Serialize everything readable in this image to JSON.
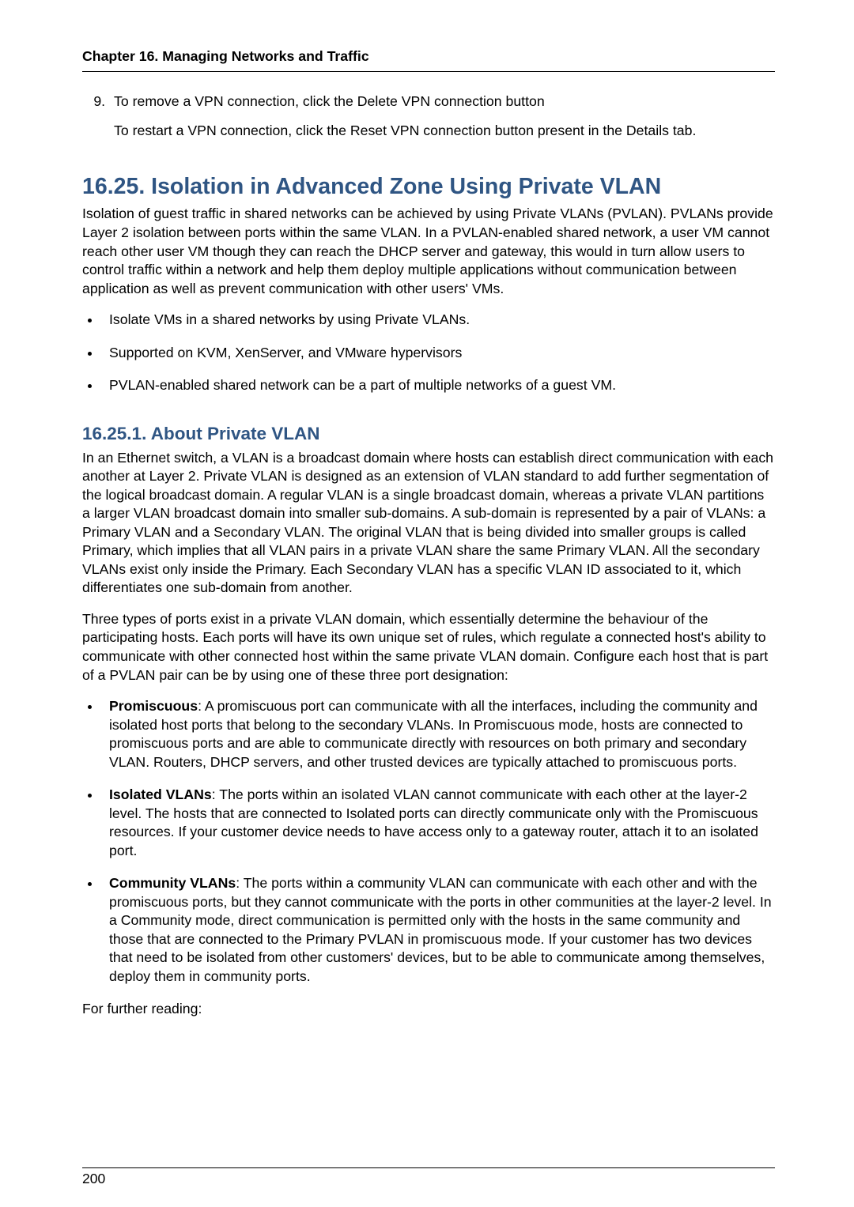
{
  "header": {
    "running": "Chapter 16. Managing Networks and Traffic"
  },
  "ol_start": 9,
  "step9": {
    "line1": "To remove a VPN connection, click the Delete VPN connection button",
    "line2": "To restart a VPN connection, click the Reset VPN connection button present in the Details tab."
  },
  "sec1625": {
    "title": "16.25. Isolation in Advanced Zone Using Private VLAN",
    "intro": "Isolation of guest traffic in shared networks can be achieved by using Private VLANs (PVLAN). PVLANs provide Layer 2 isolation between ports within the same VLAN. In a PVLAN-enabled shared network, a user VM cannot reach other user VM though they can reach the DHCP server and gateway, this would in turn allow users to control traffic within a network and help them deploy multiple applications without communication between application as well as prevent communication with other users' VMs.",
    "bullets": [
      "Isolate VMs in a shared networks by using Private VLANs.",
      "Supported on KVM, XenServer, and VMware hypervisors",
      "PVLAN-enabled shared network can be a part of multiple networks of a guest VM."
    ]
  },
  "sec16251": {
    "title": "16.25.1. About Private VLAN",
    "p1": "In an Ethernet switch, a VLAN is a broadcast domain where hosts can establish direct communication with each another at Layer 2. Private VLAN is designed as an extension of VLAN standard to add further segmentation of the logical broadcast domain. A regular VLAN is a single broadcast domain, whereas a private VLAN partitions a larger VLAN broadcast domain into smaller sub-domains. A sub-domain is represented by a pair of VLANs: a Primary VLAN and a Secondary VLAN. The original VLAN that is being divided into smaller groups is called Primary, which implies that all VLAN pairs in a private VLAN share the same Primary VLAN. All the secondary VLANs exist only inside the Primary. Each Secondary VLAN has a specific VLAN ID associated to it, which differentiates one sub-domain from another.",
    "p2": "Three types of ports exist in a private VLAN domain, which essentially determine the behaviour of the participating hosts. Each ports will have its own unique set of rules, which regulate a connected host's ability to communicate with other connected host within the same private VLAN domain. Configure each host that is part of a PVLAN pair can be by using one of these three port designation:",
    "defs": [
      {
        "term": "Promiscuous",
        "text": ": A promiscuous port can communicate with all the interfaces, including the community and isolated host ports that belong to the secondary VLANs. In Promiscuous mode, hosts are connected to promiscuous ports and are able to communicate directly with resources on both primary and secondary VLAN. Routers, DHCP servers, and other trusted devices are typically attached to promiscuous ports."
      },
      {
        "term": "Isolated VLANs",
        "text": ": The ports within an isolated VLAN cannot communicate with each other at the layer-2 level. The hosts that are connected to Isolated ports can directly communicate only with the Promiscuous resources. If your customer device needs to have access only to a gateway router, attach it to an isolated port."
      },
      {
        "term": "Community VLANs",
        "text": ": The ports within a community VLAN can communicate with each other and with the promiscuous ports, but they cannot communicate with the ports in other communities at the layer-2 level. In a Community mode, direct communication is permitted only with the hosts in the same community and those that are connected to the Primary PVLAN in promiscuous mode. If your customer has two devices that need to be isolated from other customers' devices, but to be able to communicate among themselves, deploy them in community ports."
      }
    ],
    "outro": "For further reading:"
  },
  "footer": {
    "page": "200"
  }
}
